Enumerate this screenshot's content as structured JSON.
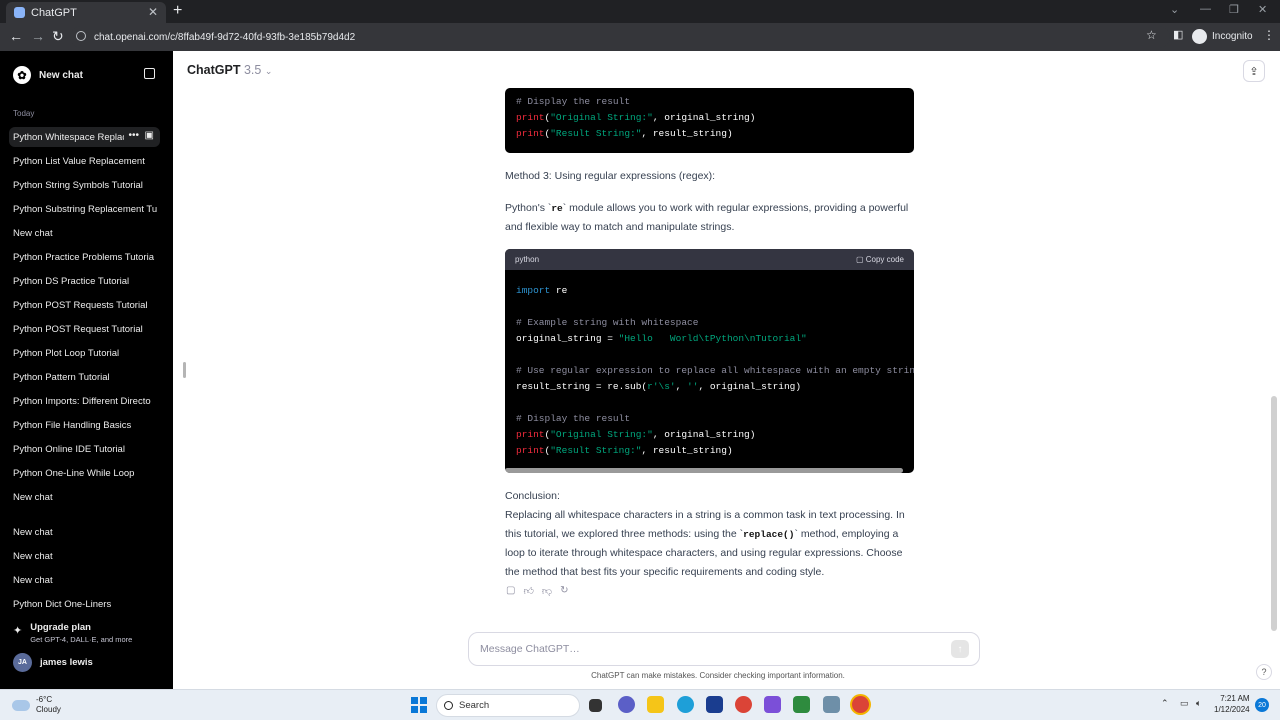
{
  "browser": {
    "tab_title": "ChatGPT",
    "url": "chat.openai.com/c/8ffab49f-9d72-40fd-93fb-3e185b79d4d2",
    "incognito_label": "Incognito"
  },
  "sidebar": {
    "new_chat": "New chat",
    "section_today": "Today",
    "items": [
      "Python Whitespace Replac",
      "Python List Value Replacement",
      "Python String Symbols Tutorial",
      "Python Substring Replacement Tu",
      "New chat",
      "Python Practice Problems Tutoria",
      "Python DS Practice Tutorial",
      "Python POST Requests Tutorial",
      "Python POST Request Tutorial",
      "Python Plot Loop Tutorial",
      "Python Pattern Tutorial",
      "Python Imports: Different Directo",
      "Python File Handling Basics",
      "Python Online IDE Tutorial",
      "Python One-Line While Loop",
      "New chat",
      "New chat",
      "New chat",
      "New chat",
      "Python Dict One-Liners"
    ],
    "upgrade_title": "Upgrade plan",
    "upgrade_sub": "Get GPT-4, DALL·E, and more",
    "user_initials": "JA",
    "user_name": "james lewis"
  },
  "header": {
    "model": "ChatGPT",
    "version": "3.5"
  },
  "content": {
    "top_code": [
      "# Display the result",
      "print(\"Original String:\", original_string)",
      "print(\"Result String:\", result_string)"
    ],
    "method3_title": "Method 3: Using regular expressions (regex):",
    "method3_pre": "Python's `",
    "method3_code": "re",
    "method3_post": "` module allows you to work with regular expressions, providing a powerful and flexible way to match and manipulate strings.",
    "code_lang": "python",
    "copy_code": "Copy code",
    "code_lines": {
      "l1_kw": "import",
      "l1_rest": " re",
      "l2": "# Example string with whitespace",
      "l3_a": "original_string = ",
      "l3_s": "\"Hello   World\\tPython\\nTutorial\"",
      "l4": "# Use regular expression to replace all whitespace with an empty string",
      "l5_a": "result_string = re.sub(",
      "l5_s1": "r'\\s'",
      "l5_b": ", ",
      "l5_s2": "''",
      "l5_c": ", original_string)",
      "l6": "# Display the result",
      "l7_f": "print",
      "l7_a": "(",
      "l7_s": "\"Original String:\"",
      "l7_b": ", original_string)",
      "l8_f": "print",
      "l8_a": "(",
      "l8_s": "\"Result String:\"",
      "l8_b": ", result_string)"
    },
    "conclusion_title": "Conclusion:",
    "conclusion_pre": "Replacing all whitespace characters in a string is a common task in text processing. In this tutorial, we explored three methods: using the `",
    "conclusion_code": "replace()",
    "conclusion_post": "` method, employing a loop to iterate through whitespace characters, and using regular expressions. Choose the method that best fits your specific requirements and coding style."
  },
  "composer": {
    "placeholder": "Message ChatGPT…",
    "disclaimer": "ChatGPT can make mistakes. Consider checking important information.",
    "help": "?"
  },
  "taskbar": {
    "temp": "-6°C",
    "condition": "Cloudy",
    "search": "Search",
    "time": "7:21 AM",
    "date": "1/12/2024",
    "notif_count": "20"
  }
}
